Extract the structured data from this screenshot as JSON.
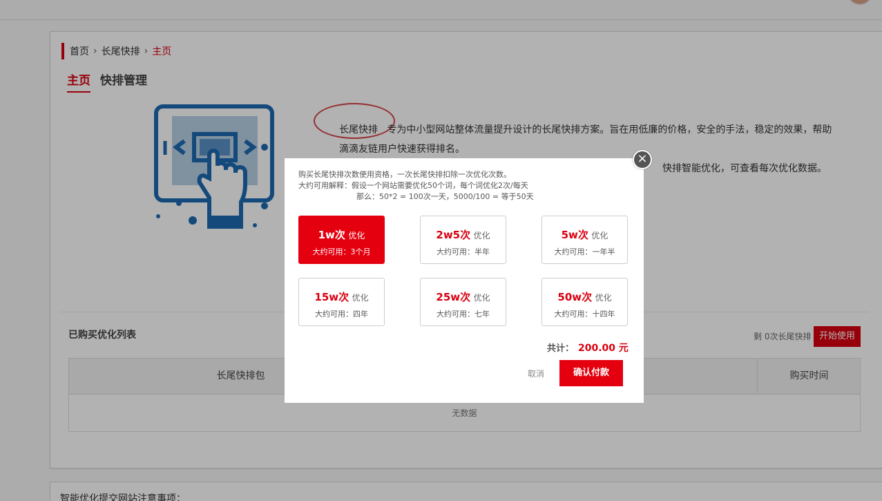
{
  "breadcrumb": {
    "home": "首页",
    "section": "长尾快排",
    "current": "主页"
  },
  "tabs": [
    {
      "label": "主页"
    },
    {
      "label": "快排管理"
    }
  ],
  "intro": {
    "product_name": "长尾快排",
    "line1": "专为中小型网站整体流量提升设计的长尾快排方案。旨在用低廉的价格，安全的手法，稳定的效果，帮助滴滴友链用户快速获得排名。",
    "line2": "快排智能优化，可查看每次优化数据。"
  },
  "purchased": {
    "title": "已购买优化列表",
    "remaining": "剩 0次长尾快排",
    "start_button": "开始使用",
    "columns": [
      "长尾快排包",
      "购买时间"
    ],
    "empty": "无数据"
  },
  "notes_title": "智能优化提交网站注意事项：",
  "modal": {
    "close": "×",
    "desc_line1": "购买长尾快排次数使用资格，一次长尾快排扣除一次优化次数。",
    "desc_line2": "大约可用解释：假设一个网站需要优化50个词，每个词优化2次/每天",
    "desc_line3": "那么：50*2 = 100次一天，5000/100 = 等于50天",
    "packages": [
      {
        "qty": "1w次",
        "suffix": "优化",
        "usage": "大约可用：3个月"
      },
      {
        "qty": "2w5次",
        "suffix": "优化",
        "usage": "大约可用：半年"
      },
      {
        "qty": "5w次",
        "suffix": "优化",
        "usage": "大约可用：一年半"
      },
      {
        "qty": "15w次",
        "suffix": "优化",
        "usage": "大约可用：四年"
      },
      {
        "qty": "25w次",
        "suffix": "优化",
        "usage": "大约可用：七年"
      },
      {
        "qty": "50w次",
        "suffix": "优化",
        "usage": "大约可用：十四年"
      }
    ],
    "selected_index": 0,
    "total_label": "共计：",
    "total_amount": "200.00 元",
    "cancel": "取消",
    "confirm": "确认付款"
  },
  "colors": {
    "accent": "#e4000f",
    "icon_blue": "#1e6bb0"
  }
}
